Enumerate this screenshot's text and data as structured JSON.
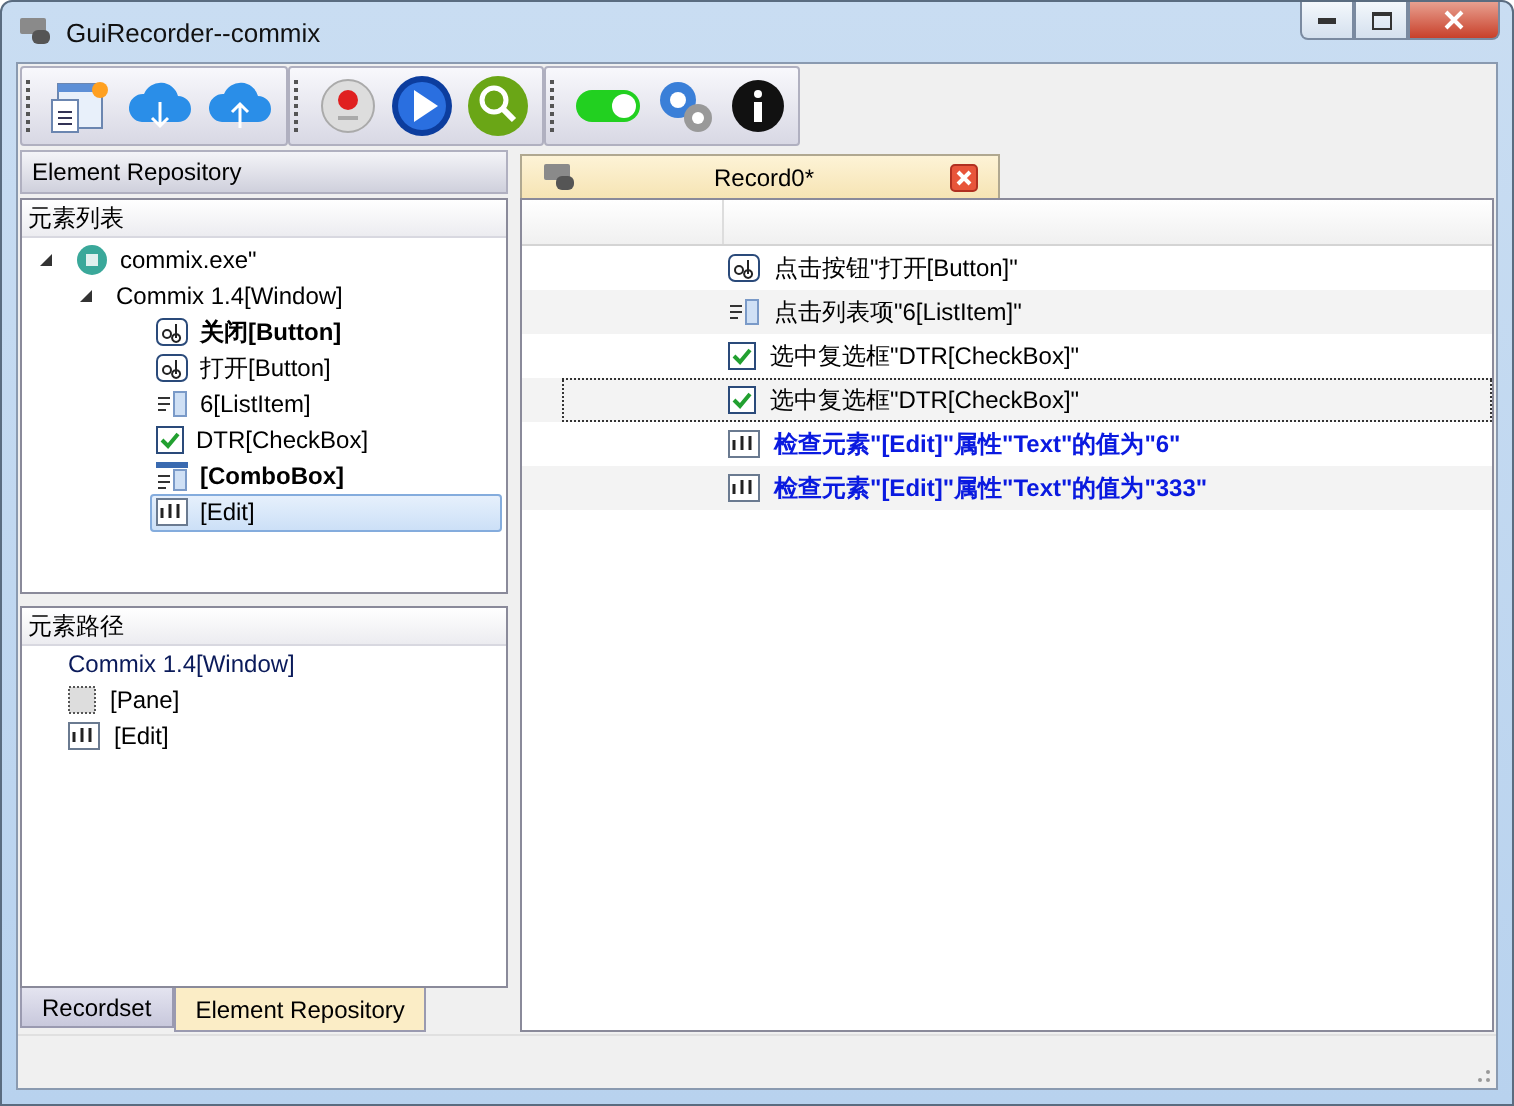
{
  "window": {
    "title": "GuiRecorder--commix"
  },
  "toolbar": {
    "toggle": {
      "on": true
    }
  },
  "left_panel": {
    "title": "Element Repository",
    "element_list": {
      "title": "元素列表",
      "tree": [
        {
          "label": "commix.exe\"",
          "kind": "app",
          "bold": false,
          "selected": false,
          "expanded": true,
          "children": [
            {
              "label": "Commix 1.4[Window]",
              "bold": false,
              "selected": false,
              "expanded": true,
              "children": [
                {
                  "label": "关闭[Button]",
                  "kind": "button",
                  "bold": true,
                  "selected": false
                },
                {
                  "label": "打开[Button]",
                  "kind": "button",
                  "bold": false,
                  "selected": false
                },
                {
                  "label": "6[ListItem]",
                  "kind": "listitem",
                  "bold": false,
                  "selected": false
                },
                {
                  "label": "DTR[CheckBox]",
                  "kind": "checkbox",
                  "bold": false,
                  "selected": false
                },
                {
                  "label": "[ComboBox]",
                  "kind": "combobox",
                  "bold": true,
                  "selected": false
                },
                {
                  "label": "[Edit]",
                  "kind": "edit",
                  "bold": false,
                  "selected": true
                }
              ]
            }
          ]
        }
      ]
    },
    "element_path": {
      "title": "元素路径",
      "items": [
        {
          "label": "Commix 1.4[Window]"
        },
        {
          "label": "[Pane]",
          "kind": "pane"
        },
        {
          "label": "[Edit]",
          "kind": "edit"
        }
      ]
    },
    "tabs": [
      {
        "label": "Recordset",
        "selected": false
      },
      {
        "label": "Element Repository",
        "selected": true
      }
    ]
  },
  "document": {
    "tab": {
      "label": "Record0*"
    },
    "rows": [
      {
        "kind": "button",
        "text": "点击按钮\"打开[Button]\"",
        "emphasis": false,
        "selected": false
      },
      {
        "kind": "listitem",
        "text": "点击列表项\"6[ListItem]\"",
        "emphasis": false,
        "selected": false
      },
      {
        "kind": "checkbox",
        "text": "选中复选框\"DTR[CheckBox]\"",
        "emphasis": false,
        "selected": false
      },
      {
        "kind": "checkbox",
        "text": "选中复选框\"DTR[CheckBox]\"",
        "emphasis": false,
        "selected": true
      },
      {
        "kind": "edit",
        "text": "检查元素\"[Edit]\"属性\"Text\"的值为\"6\"",
        "emphasis": true,
        "selected": false
      },
      {
        "kind": "edit",
        "text": "检查元素\"[Edit]\"属性\"Text\"的值为\"333\"",
        "emphasis": true,
        "selected": false
      }
    ]
  }
}
